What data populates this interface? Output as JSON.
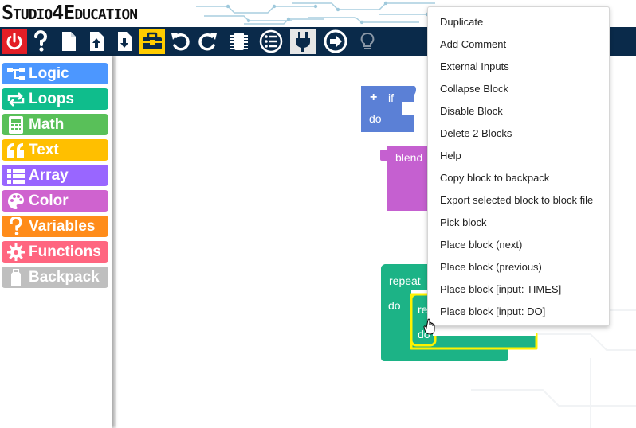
{
  "header": {
    "logo_text": "Studio4Education"
  },
  "toolbar": {
    "buttons": [
      {
        "name": "power-icon"
      },
      {
        "name": "help-icon"
      },
      {
        "name": "new-file-icon"
      },
      {
        "name": "upload-icon"
      },
      {
        "name": "download-icon"
      },
      {
        "name": "toolbox-icon"
      },
      {
        "name": "undo-icon"
      },
      {
        "name": "redo-icon"
      },
      {
        "name": "chip-icon"
      },
      {
        "name": "checklist-icon"
      },
      {
        "name": "plug-icon"
      },
      {
        "name": "export-arrow-icon"
      },
      {
        "name": "lightbulb-icon"
      }
    ]
  },
  "toolbox": {
    "categories": [
      {
        "label": "Logic",
        "color": "#4c97ff",
        "icon": "logic-icon"
      },
      {
        "label": "Loops",
        "color": "#0fbd8c",
        "icon": "loops-icon"
      },
      {
        "label": "Math",
        "color": "#59c059",
        "icon": "calculator-icon"
      },
      {
        "label": "Text",
        "color": "#ffbf00",
        "icon": "quote-icon"
      },
      {
        "label": "Array",
        "color": "#9966ff",
        "icon": "list-icon"
      },
      {
        "label": "Color",
        "color": "#cf63cf",
        "icon": "palette-icon"
      },
      {
        "label": "Variables",
        "color": "#ff8c1a",
        "icon": "question-icon"
      },
      {
        "label": "Functions",
        "color": "#ff6680",
        "icon": "gear-icon"
      },
      {
        "label": "Backpack",
        "color": "#bfbfbf",
        "icon": "backpack-icon"
      }
    ]
  },
  "workspace": {
    "if_block": {
      "plus": "+",
      "if_label": "if",
      "do_label": "do",
      "color": "#5b80d6"
    },
    "blend_block": {
      "label": "blend",
      "color": "#c560d0"
    },
    "repeat_block": {
      "repeat_label": "repeat",
      "do_label": "do",
      "color": "#1cb386"
    },
    "inner_block": {
      "label_top": "re",
      "label_do": "do",
      "highlight": "#fff200"
    }
  },
  "context_menu": {
    "items": [
      "Duplicate",
      "Add Comment",
      "External Inputs",
      "Collapse Block",
      "Disable Block",
      "Delete 2 Blocks",
      "Help",
      "Copy block to backpack",
      "Export selected block to block file",
      "Pick block",
      "Place block (next)",
      "Place block (previous)",
      "Place block [input: TIMES]",
      "Place block [input: DO]"
    ]
  }
}
